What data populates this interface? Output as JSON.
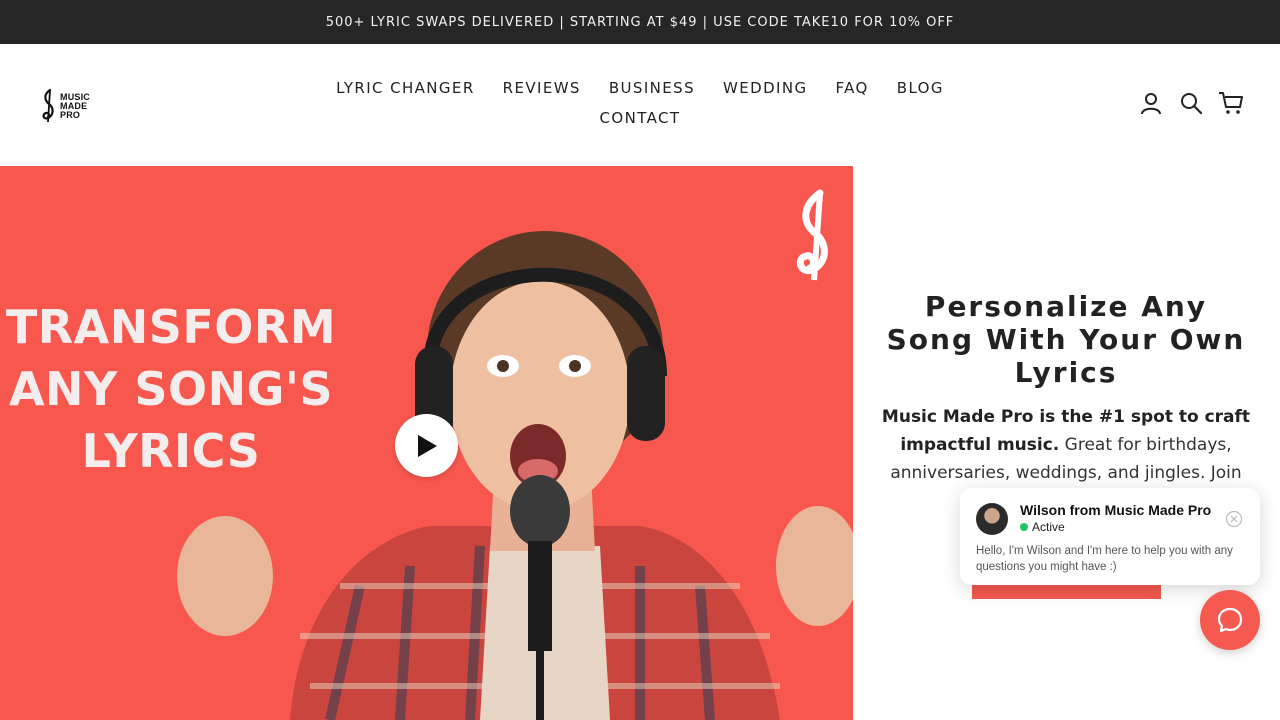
{
  "announcement": "500+ LYRIC SWAPS DELIVERED | STARTING AT $49 | USE CODE TAKE10 FOR 10% OFF",
  "logo": {
    "line1": "MUSIC",
    "line2": "MADE",
    "line3": "PRO"
  },
  "nav": {
    "lyric_changer": "LYRIC CHANGER",
    "reviews": "REVIEWS",
    "business": "BUSINESS",
    "wedding": "WEDDING",
    "faq": "FAQ",
    "blog": "BLOG",
    "contact": "CONTACT"
  },
  "header_icons": [
    "account-icon",
    "search-icon",
    "cart-icon"
  ],
  "hero_media": {
    "line1": "TRANSFORM",
    "line2": "ANY SONG'S",
    "line3": "LYRICS",
    "play_icon": "play-icon",
    "background_color": "#f8574e"
  },
  "hero": {
    "title": "Personalize Any Song With Your Own Lyrics",
    "desc_bold": "Music Made Pro is the #1 spot to craft impactful music.",
    "desc_rest": " Great for birthdays, anniversaries, weddings, and jingles. Join 1,0"
  },
  "chat": {
    "name": "Wilson from Music Made Pro",
    "status": "Active",
    "message": "Hello, I'm Wilson and I'm here to help you with any questions you might have :)"
  },
  "colors": {
    "accent": "#f45a4f",
    "announcement_bg": "#262626",
    "status_green": "#22c55e"
  }
}
